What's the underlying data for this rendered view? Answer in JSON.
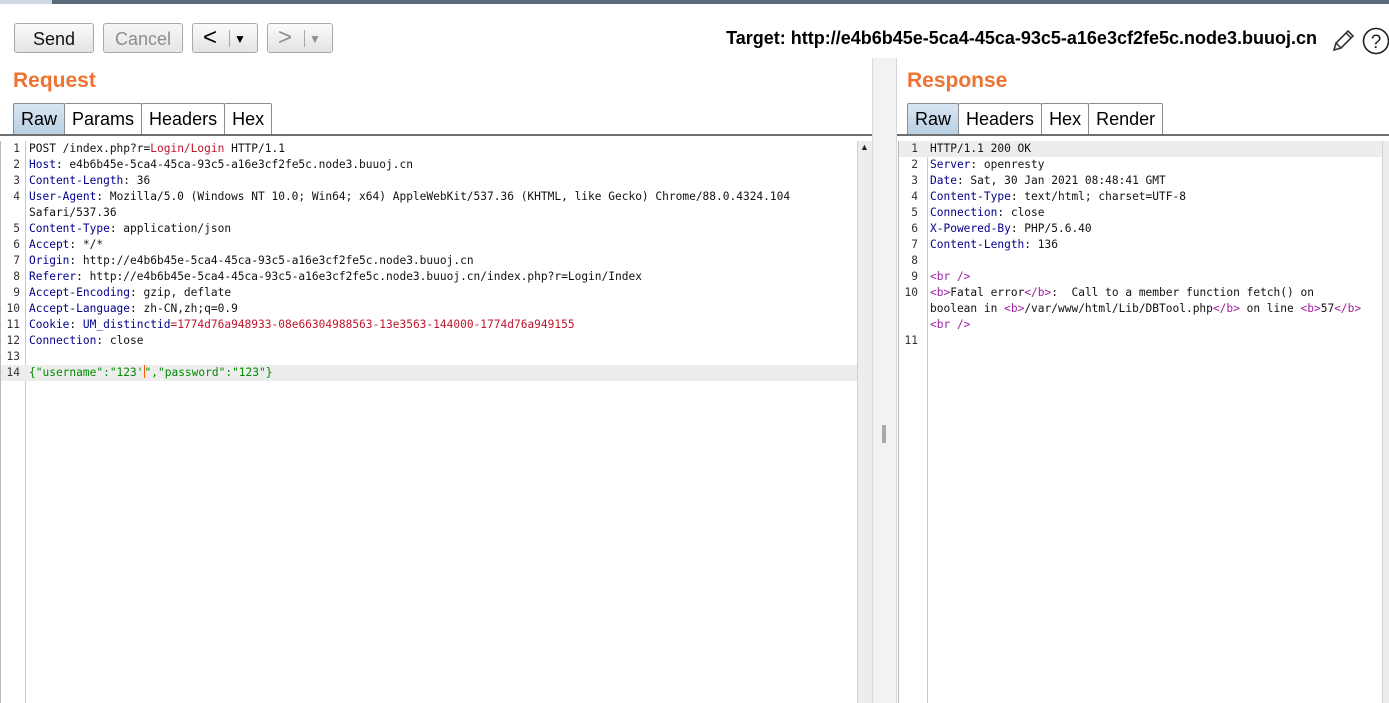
{
  "toolbar": {
    "send_label": "Send",
    "cancel_label": "Cancel",
    "back_arrow": "<",
    "forward_arrow": ">",
    "dropdown_glyph": "▼",
    "target_text": "Target: http://e4b6b45e-5ca4-45ca-93c5-a16e3cf2fe5c.node3.buuoj.cn",
    "icons": [
      "pencil-icon",
      "help-icon"
    ]
  },
  "request": {
    "title": "Request",
    "tabs": [
      "Raw",
      "Params",
      "Headers",
      "Hex"
    ],
    "active_tab": "Raw",
    "line_numbers": [
      "1",
      "2",
      "3",
      "4",
      "",
      "5",
      "6",
      "7",
      "8",
      "9",
      "10",
      "11",
      "12",
      "13",
      "14"
    ],
    "lines": [
      {
        "text": "POST /index.php?r=",
        "red": "Login/Login",
        "rest": " HTTP/1.1"
      },
      {
        "key": "Host",
        "rest": ": e4b6b45e-5ca4-45ca-93c5-a16e3cf2fe5c.node3.buuoj.cn"
      },
      {
        "key": "Content-Length",
        "rest": ": 36"
      },
      {
        "key": "User-Agent",
        "rest": ": Mozilla/5.0 (Windows NT 10.0; Win64; x64) AppleWebKit/537.36 (KHTML, like Gecko) Chrome/88.0.4324.104"
      },
      {
        "text": "Safari/537.36"
      },
      {
        "key": "Content-Type",
        "rest": ": application/json"
      },
      {
        "key": "Accept",
        "rest": ": */*"
      },
      {
        "key": "Origin",
        "rest": ": http://e4b6b45e-5ca4-45ca-93c5-a16e3cf2fe5c.node3.buuoj.cn"
      },
      {
        "key": "Referer",
        "rest": ": http://e4b6b45e-5ca4-45ca-93c5-a16e3cf2fe5c.node3.buuoj.cn/index.php?r=Login/Index"
      },
      {
        "key": "Accept-Encoding",
        "rest": ": gzip, deflate"
      },
      {
        "key": "Accept-Language",
        "rest": ": zh-CN,zh;q=0.9"
      },
      {
        "key": "Cookie",
        "rest": ": ",
        "cookie_name": "UM_distinctid",
        "cookie_value": "=1774d76a948933-08e66304988563-13e3563-144000-1774d76a949155"
      },
      {
        "key": "Connection",
        "rest": ": close"
      },
      {
        "text": ""
      },
      {
        "json_body": true,
        "p1": "{\"username\":\"123'",
        "p2": "\",\"password\":\"123\"}"
      }
    ]
  },
  "response": {
    "title": "Response",
    "tabs": [
      "Raw",
      "Headers",
      "Hex",
      "Render"
    ],
    "active_tab": "Raw",
    "line_numbers": [
      "1",
      "2",
      "3",
      "4",
      "5",
      "6",
      "7",
      "8",
      "9",
      "10",
      "",
      "",
      "11"
    ],
    "lines": [
      {
        "text": "HTTP/1.1 200 OK"
      },
      {
        "key": "Server",
        "rest": ": openresty"
      },
      {
        "key": "Date",
        "rest": ": Sat, 30 Jan 2021 08:48:41 GMT"
      },
      {
        "key": "Content-Type",
        "rest": ": text/html; charset=UTF-8"
      },
      {
        "key": "Connection",
        "rest": ": close"
      },
      {
        "key": "X-Powered-By",
        "rest": ": PHP/5.6.40"
      },
      {
        "key": "Content-Length",
        "rest": ": 136"
      },
      {
        "text": ""
      },
      {
        "tag": "<br />"
      },
      {
        "tag": "<b>",
        "rest": "Fatal error",
        "tag2": "</b>",
        "rest2": ":  Call to a member function fetch() on"
      },
      {
        "rest": "boolean in ",
        "tag": "<b>",
        "rest2": "/var/www/html/Lib/DBTool.php",
        "tag2": "</b>",
        "rest3": " on line ",
        "tag3": "<b>",
        "rest4": "57",
        "tag4": "</b>"
      },
      {
        "tag": "<br />"
      },
      {
        "text": ""
      }
    ]
  }
}
